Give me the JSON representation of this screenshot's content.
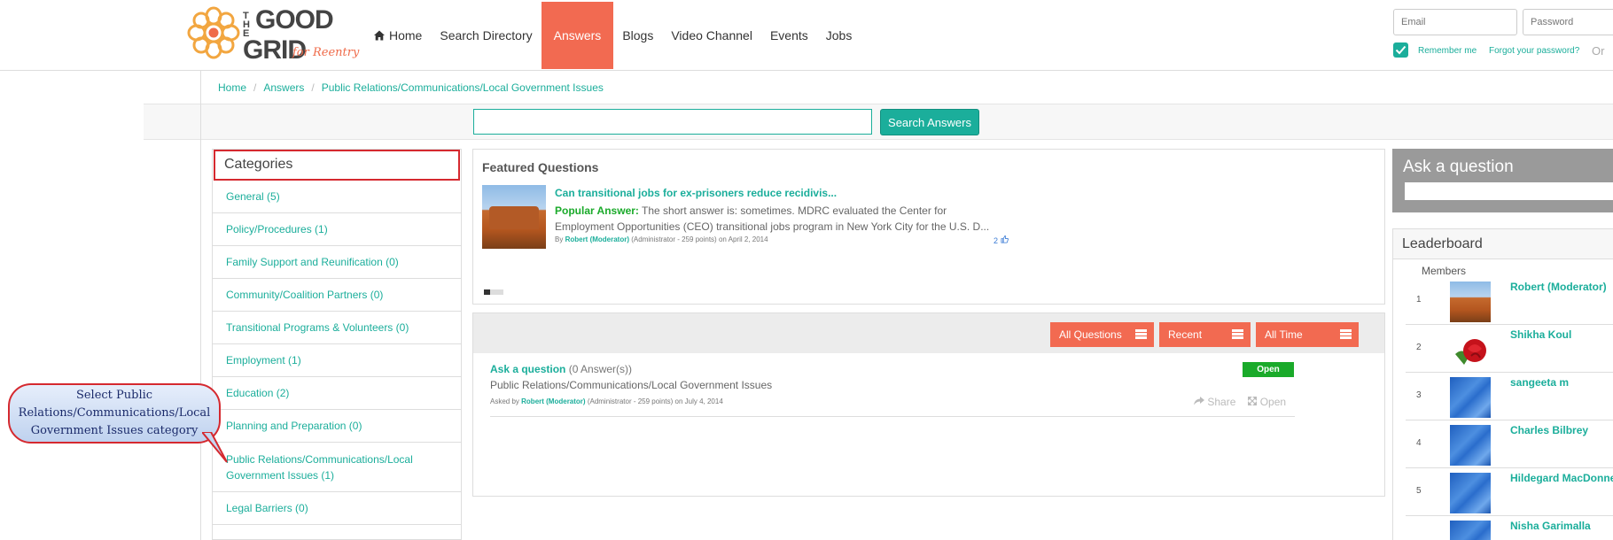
{
  "header": {
    "logo": {
      "text_the": "THE",
      "text_good": "GOOD",
      "text_grid": "GRID",
      "text_tagline": "for Reentry"
    },
    "nav": [
      {
        "label": "Home",
        "icon": "home-icon"
      },
      {
        "label": "Search Directory"
      },
      {
        "label": "Answers",
        "active": true
      },
      {
        "label": "Blogs"
      },
      {
        "label": "Video Channel"
      },
      {
        "label": "Events"
      },
      {
        "label": "Jobs"
      }
    ],
    "login": {
      "email_placeholder": "Email",
      "password_placeholder": "Password",
      "remember_label": "Remember me",
      "forgot_label": "Forgot your password?",
      "or_label": "Or"
    }
  },
  "breadcrumb": [
    "Home",
    "Answers",
    "Public Relations/Communications/Local Government Issues"
  ],
  "search": {
    "button_label": "Search Answers",
    "value": ""
  },
  "categories": {
    "title": "Categories",
    "items": [
      "General (5)",
      "Policy/Procedures (1)",
      "Family Support and Reunification (0)",
      "Community/Coalition Partners (0)",
      "Transitional Programs & Volunteers (0)",
      "Employment (1)",
      "Education (2)",
      "Planning and Preparation (0)",
      "Public Relations/Communications/Local Government Issues (1)",
      "Legal Barriers (0)"
    ]
  },
  "callout": {
    "text": "Select Public Relations/Communications/Local Government Issues category"
  },
  "featured": {
    "title": "Featured Questions",
    "question": "Can transitional jobs for ex-prisoners reduce recidivis...",
    "answer_label": "Popular Answer:",
    "answer_text": " The short answer is: sometimes. MDRC evaluated the Center for Employment Opportunities (CEO) transitional jobs program in New York City for the U.S. D...",
    "by_prefix": "By ",
    "by_user": "Robert (Moderator)",
    "by_meta": " (Administrator - 259 points)  on April 2, 2014",
    "likes": "2"
  },
  "questions": {
    "filters": [
      "All Questions",
      "Recent",
      "All Time"
    ],
    "item": {
      "title": "Ask a question",
      "answers": " (0 Answer(s))",
      "category": "Public Relations/Communications/Local Government Issues",
      "asked_prefix": "Asked by ",
      "asked_user": "Robert (Moderator)",
      "asked_meta": " (Administrator - 259 points)  on July 4, 2014",
      "status": "Open",
      "share_label": "Share",
      "open_label": "Open"
    }
  },
  "ask_box": {
    "title": "Ask a question"
  },
  "leaderboard": {
    "title": "Leaderboard",
    "subtitle": "Members",
    "members": [
      {
        "rank": "1",
        "name": "Robert (Moderator)",
        "avatar": "rock"
      },
      {
        "rank": "2",
        "name": "Shikha Koul",
        "avatar": "rose"
      },
      {
        "rank": "3",
        "name": "sangeeta m",
        "avatar": "blue"
      },
      {
        "rank": "4",
        "name": "Charles Bilbrey",
        "avatar": "blue"
      },
      {
        "rank": "5",
        "name": "Hildegard MacDonnell",
        "avatar": "blue"
      },
      {
        "rank": "",
        "name": "Nisha Garimalla",
        "avatar": "blue"
      }
    ]
  }
}
